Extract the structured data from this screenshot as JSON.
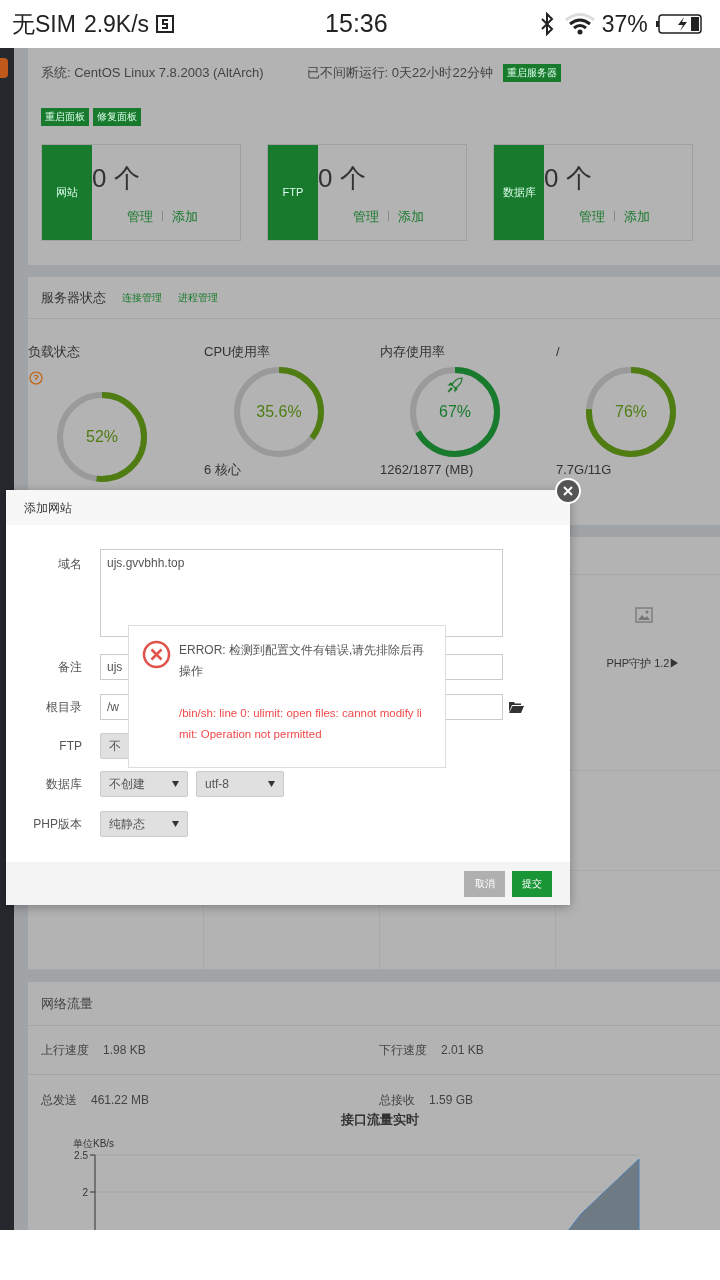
{
  "status_bar": {
    "carrier": "无SIM",
    "speed": "2.9K/s",
    "time": "15:36",
    "battery": "37%"
  },
  "system": {
    "os": "系统: CentOS Linux 7.8.2003 (AltArch)",
    "uptime": "已不间断运行: 0天22小时22分钟",
    "restart_server": "重启服务器",
    "buttons": [
      "重启面板",
      "修复面板"
    ]
  },
  "counters": [
    {
      "label": "网站",
      "count": "0 个",
      "links": [
        "管理",
        "添加"
      ]
    },
    {
      "label": "FTP",
      "count": "0 个",
      "links": [
        "管理",
        "添加"
      ]
    },
    {
      "label": "数据库",
      "count": "0 个",
      "links": [
        "管理",
        "添加"
      ]
    }
  ],
  "server_status": {
    "title": "服务器状态",
    "links": [
      "连接管理",
      "进程管理"
    ],
    "gauges": [
      {
        "kind": "help",
        "title": "负载状态",
        "value": "52%",
        "level": 0.52,
        "color": "#4f7d12"
      },
      {
        "kind": "plain",
        "title": "CPU使用率",
        "value": "35.6%",
        "level": 0.356,
        "color": "#4f7d12",
        "detail": "6 核心"
      },
      {
        "kind": "rocket",
        "title": "内存使用率",
        "value": "67%",
        "level": 0.67,
        "color": "#187a2c",
        "detail": "1262/1877 (MB)"
      },
      {
        "kind": "plain",
        "title": "/",
        "value": "76%",
        "level": 0.76,
        "color": "#4f7d12",
        "detail": "7.7G/11G"
      }
    ]
  },
  "software": {
    "item": "PHP守护 1.2▶"
  },
  "network": {
    "title": "网络流量",
    "stats": [
      {
        "label": "上行速度",
        "value": "1.98 KB"
      },
      {
        "label": "下行速度",
        "value": "2.01 KB"
      },
      {
        "label": "总发送",
        "value": "461.22 MB"
      },
      {
        "label": "总接收",
        "value": "1.59 GB"
      }
    ],
    "chart": {
      "title": "接口流量实时",
      "unit": "单位KB/s",
      "tick_labels": [
        "2.5",
        "2"
      ]
    }
  },
  "dialog": {
    "title": "添加网站",
    "fields": [
      {
        "kind": "textarea",
        "label": "域名",
        "value": "ujs.gvvbhh.top"
      },
      {
        "kind": "input",
        "label": "备注",
        "value": "ujs"
      },
      {
        "kind": "folder",
        "label": "根目录",
        "value": "/w"
      },
      {
        "kind": "select_covered",
        "label": "FTP",
        "values": [
          "不"
        ]
      },
      {
        "kind": "select",
        "label": "数据库",
        "values": [
          "不创建",
          "utf-8"
        ]
      },
      {
        "kind": "select",
        "label": "PHP版本",
        "values": [
          "纯静态"
        ]
      }
    ],
    "cancel": "取消",
    "submit": "提交"
  },
  "error": {
    "title": "ERROR: 检测到配置文件有错误,请先排除后再操作",
    "detail": "/bin/sh: line 0: ulimit: open files: cannot modify limit: Operation not permitted"
  }
}
